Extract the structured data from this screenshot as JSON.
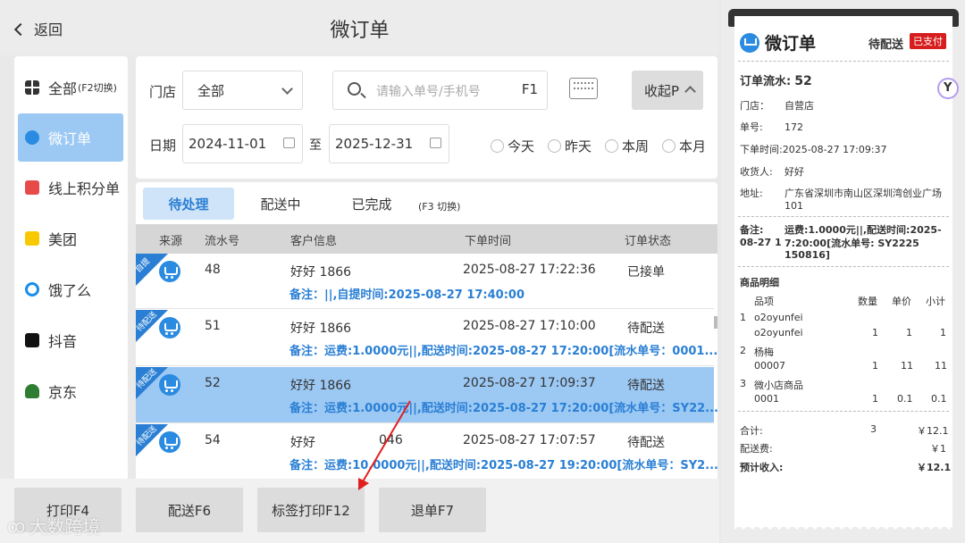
{
  "header": {
    "back_label": "返回",
    "title": "微订单"
  },
  "sidebar": {
    "items": [
      {
        "label": "全部",
        "suffix": "(F2切换)",
        "icon": "grid-icon",
        "color": "#333333"
      },
      {
        "label": "微订单",
        "suffix": "",
        "icon": "cart-icon",
        "color": "#2a8be0"
      },
      {
        "label": "线上积分单",
        "suffix": "",
        "icon": "gift-icon",
        "color": "#e84a4a"
      },
      {
        "label": "美团",
        "suffix": "",
        "icon": "meituan-icon",
        "color": "#f8c900"
      },
      {
        "label": "饿了么",
        "suffix": "",
        "icon": "eleme-icon",
        "color": "#1a8ee8"
      },
      {
        "label": "抖音",
        "suffix": "",
        "icon": "douyin-icon",
        "color": "#111111"
      },
      {
        "label": "京东",
        "suffix": "",
        "icon": "jd-icon",
        "color": "#2e7d32"
      }
    ]
  },
  "filter": {
    "store_label": "门店",
    "store_value": "全部",
    "search_placeholder": "请输入单号/手机号",
    "search_shortcut": "F1",
    "collapse_label": "收起P",
    "date_label": "日期",
    "date_from": "2024-11-01",
    "date_sep": "至",
    "date_to": "2025-12-31",
    "quick_ranges": [
      "今天",
      "昨天",
      "本周",
      "本月"
    ]
  },
  "tabs": {
    "items": [
      "待处理",
      "配送中",
      "已完成"
    ],
    "hint": "(F3 切换)"
  },
  "table": {
    "columns": [
      "来源",
      "流水号",
      "客户信息",
      "下单时间",
      "订单状态"
    ],
    "rows": [
      {
        "ribbon": "自提",
        "serial": "48",
        "customer": "好好  1866",
        "time": "2025-08-27 17:22:36",
        "status": "已接单",
        "note": "备注：||,自提时间:2025-08-27 17:40:00"
      },
      {
        "ribbon": "待配送",
        "serial": "51",
        "customer": "好好  1866",
        "time": "2025-08-27 17:10:00",
        "status": "待配送",
        "note": "备注：运费:1.0000元||,配送时间:2025-08-27 17:20:00[流水单号：0001..."
      },
      {
        "ribbon": "待配送",
        "serial": "52",
        "customer": "好好  1866",
        "time": "2025-08-27 17:09:37",
        "status": "待配送",
        "note": "备注：运费:1.0000元||,配送时间:2025-08-27 17:20:00[流水单号：SY22..."
      },
      {
        "ribbon": "待配送",
        "serial": "54",
        "customer": "好好  ",
        "customer_suffix": "046",
        "time": "2025-08-27 17:07:57",
        "status": "待配送",
        "note": "备注：运费:10.0000元||,配送时间:2025-08-27 19:20:00[流水单号：SY2..."
      }
    ]
  },
  "actions": [
    "打印F4",
    "配送F6",
    "标签打印F12",
    "退单F7"
  ],
  "receipt": {
    "brand": "微订单",
    "status": "待配送",
    "paid_badge": "已支付",
    "serial_label": "订单流水:",
    "serial": "52",
    "store_label": "门店：",
    "store": "自营店",
    "order_no_label": "单号:",
    "order_no": "172",
    "order_time_label": "下单时间:",
    "order_time": "2025-08-27 17:09:37",
    "receiver_label": "收货人:",
    "receiver": "好好",
    "address_label": "地址:",
    "address_1": "广东省深圳市南山区深圳湾创业广场",
    "address_2": "101",
    "remark_label": "备注:",
    "remark_1": "运费:1.0000元||,配送时间:2025-08-27 1",
    "remark_2": "7:20:00[流水单号:  SY2225",
    "remark_3": "150816]",
    "items_title": "商品明细",
    "items_header": [
      "品项",
      "数量",
      "单价",
      "小计"
    ],
    "items": [
      {
        "idx": "1",
        "name": "o2oyunfei",
        "code": "o2oyunfei",
        "qty": "1",
        "price": "1",
        "subtotal": "1"
      },
      {
        "idx": "2",
        "name": "杨梅",
        "code": "00007",
        "qty": "1",
        "price": "11",
        "subtotal": "11"
      },
      {
        "idx": "3",
        "name": "微小店商品",
        "code": "0001",
        "qty": "1",
        "price": "0.1",
        "subtotal": "0.1"
      }
    ],
    "total_label": "合计:",
    "total_qty": "3",
    "total_amount": "￥12.1",
    "delivery_label": "配送费:",
    "delivery_amount": "￥1",
    "expected_label": "预计收入:",
    "expected_amount": "￥12.1"
  },
  "watermark": "大数跨境",
  "colors": {
    "accent": "#2a8be0",
    "selected_row": "#9cc9f4",
    "paid": "#d71e1e",
    "note": "#2a7fd4"
  }
}
